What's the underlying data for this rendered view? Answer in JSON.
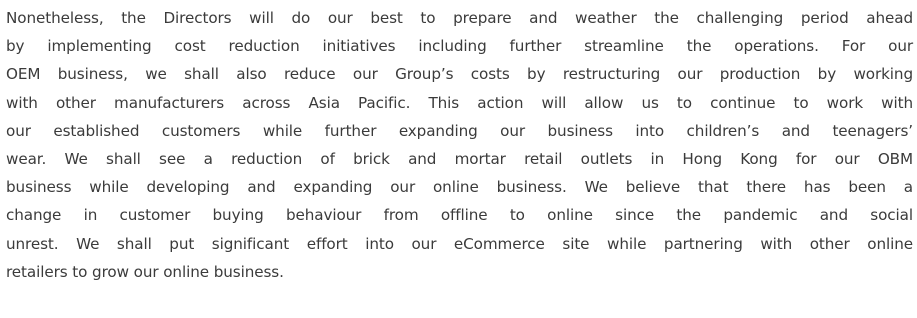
{
  "document": {
    "paragraph_lines": [
      "Nonetheless, the Directors will do our best to prepare and weather the challenging period ahead",
      "by implementing cost reduction initiatives including further streamline the operations. For our",
      "OEM business, we shall also reduce our Group’s costs by restructuring our production by working",
      "with other manufacturers across Asia Pacific. This action will allow us to continue to work with",
      "our established customers while further expanding our business into children’s and teenagers’",
      "wear. We shall see a reduction of brick and mortar retail outlets in Hong Kong for our OBM",
      "business while developing and expanding our online business. We believe that there has been a",
      "change in customer buying behaviour from offline to online since the pandemic and social",
      "unrest. We shall put significant effort into our eCommerce site while partnering with other online",
      "retailers to grow our online business."
    ]
  }
}
